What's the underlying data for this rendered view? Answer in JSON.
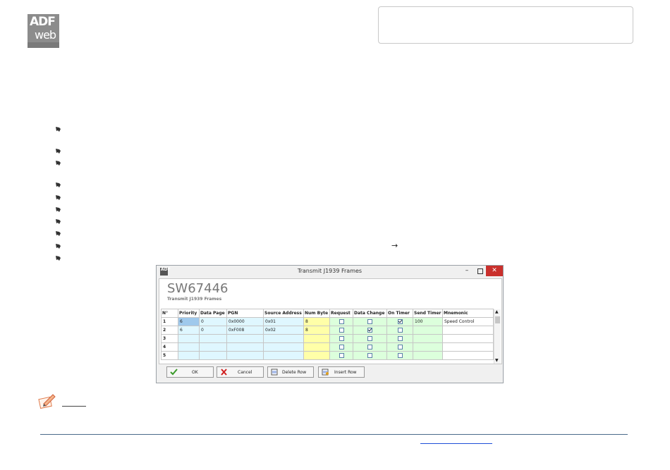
{
  "logo": {
    "line1": "ADF",
    "line2": "web"
  },
  "window": {
    "title": "Transmit J1939 Frames",
    "app_title": "SW67446",
    "app_subtitle": "Transmit J1939 Frames",
    "columns": [
      "N°",
      "Priority",
      "Data Page",
      "PGN",
      "Source Address",
      "Num Byte",
      "Request",
      "Data Change",
      "On Timer",
      "Send Timer",
      "Mnemonic"
    ],
    "rows": [
      {
        "n": "1",
        "priority": "6",
        "data_page": "0",
        "pgn": "0x0000",
        "source": "0x01",
        "num_byte": "8",
        "request": false,
        "data_change": false,
        "on_timer": true,
        "send_timer": "100",
        "mnemonic": "Speed Control"
      },
      {
        "n": "2",
        "priority": "6",
        "data_page": "0",
        "pgn": "0xF008",
        "source": "0x02",
        "num_byte": "8",
        "request": false,
        "data_change": true,
        "on_timer": false,
        "send_timer": "",
        "mnemonic": ""
      },
      {
        "n": "3",
        "priority": "",
        "data_page": "",
        "pgn": "",
        "source": "",
        "num_byte": "",
        "request": false,
        "data_change": false,
        "on_timer": false,
        "send_timer": "",
        "mnemonic": ""
      },
      {
        "n": "4",
        "priority": "",
        "data_page": "",
        "pgn": "",
        "source": "",
        "num_byte": "",
        "request": false,
        "data_change": false,
        "on_timer": false,
        "send_timer": "",
        "mnemonic": ""
      },
      {
        "n": "5",
        "priority": "",
        "data_page": "",
        "pgn": "",
        "source": "",
        "num_byte": "",
        "request": false,
        "data_change": false,
        "on_timer": false,
        "send_timer": "",
        "mnemonic": ""
      }
    ],
    "buttons": {
      "ok": "OK",
      "cancel": "Cancel",
      "delete_row": "Delete Row",
      "insert_row": "Insert Row"
    },
    "controls": {
      "minimize": "–",
      "close": "✕"
    }
  },
  "arrow_glyph": "→",
  "colors": {
    "close": "#c9302c",
    "cyan_cell": "#dff7ff",
    "yellow_cell": "#ffffa8",
    "green_cell": "#dcffdc"
  }
}
